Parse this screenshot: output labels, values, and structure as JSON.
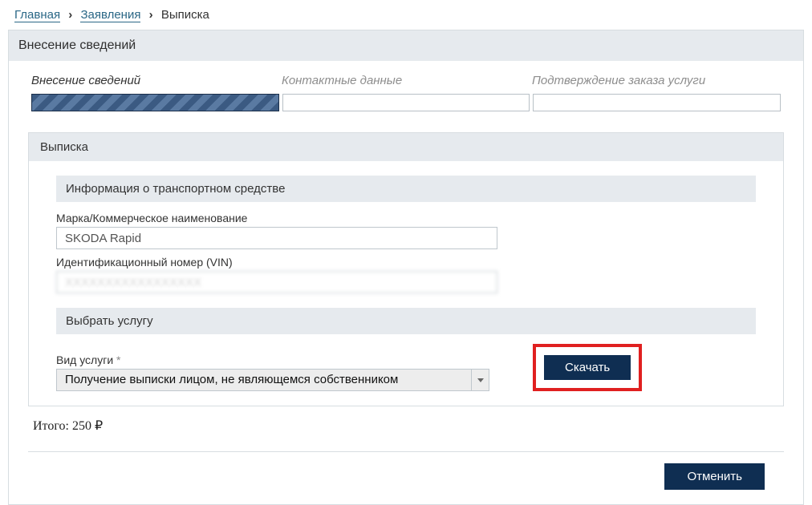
{
  "breadcrumb": {
    "home": "Главная",
    "applications": "Заявления",
    "current": "Выписка"
  },
  "panel_title": "Внесение сведений",
  "steps": [
    "Внесение сведений",
    "Контактные данные",
    "Подтверждение заказа услуги"
  ],
  "subpanel_title": "Выписка",
  "vehicle_section_title": "Информация о транспортном средстве",
  "brand_label": "Марка/Коммерческое наименование",
  "brand_value": "SKODA Rapid",
  "vin_label": "Идентификационный номер (VIN)",
  "vin_value": "XXXXXXXXXXXXXXXXX",
  "service_section_title": "Выбрать услугу",
  "service_type_label": "Вид услуги",
  "required_mark": "*",
  "service_selected": "Получение выписки лицом, не являющемся собственником",
  "download_label": "Скачать",
  "total_label": "Итого:",
  "total_value": "250 ₽",
  "cancel_label": "Отменить",
  "colors": {
    "primary_btn": "#0f2e52",
    "highlight_border": "#e02020",
    "header_bg": "#e6eaee"
  }
}
